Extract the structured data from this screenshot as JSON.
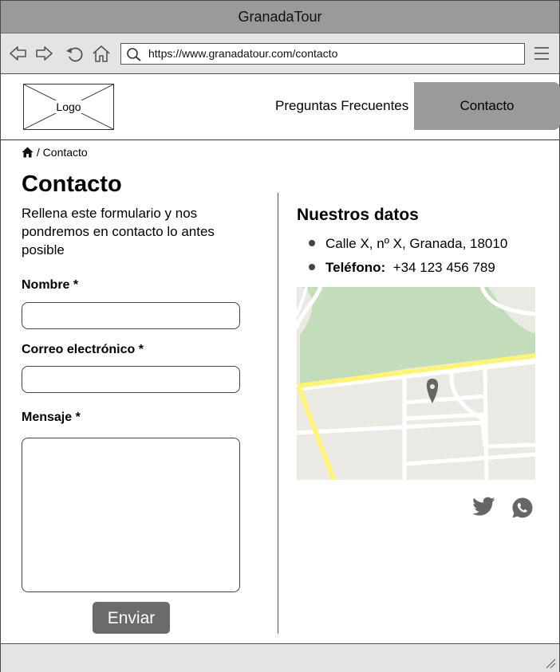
{
  "browser": {
    "title": "GranadaTour",
    "url": "https://www.granadatour.com/contacto"
  },
  "header": {
    "logo_label": "Logo",
    "nav": [
      {
        "label": "Preguntas Frecuentes"
      },
      {
        "label": "Contacto",
        "active": true
      }
    ]
  },
  "breadcrumb": {
    "separator": "/",
    "current": "Contacto"
  },
  "form": {
    "title": "Contacto",
    "intro": "Rellena este formulario y nos pondremos en contacto lo antes posible",
    "name_label": "Nombre *",
    "email_label": "Correo electrónico *",
    "message_label": "Mensaje *",
    "name_value": "",
    "email_value": "",
    "message_value": "",
    "submit_label": "Enviar"
  },
  "contact_info": {
    "title": "Nuestros datos",
    "address": "Calle X, nº X, Granada, 18010",
    "phone_label": "Teléfono:",
    "phone": "+34 123 456 789"
  },
  "social": [
    "twitter-icon",
    "whatsapp-icon"
  ],
  "colors": {
    "titlebar": "#9a9a9a",
    "toolbar": "#e4e4e4",
    "active_nav": "#9a9a9a",
    "button": "#6b6b6b",
    "map_park": "#c3dcb9",
    "map_road_major": "#fff37a",
    "map_bg": "#ebe9e3"
  }
}
